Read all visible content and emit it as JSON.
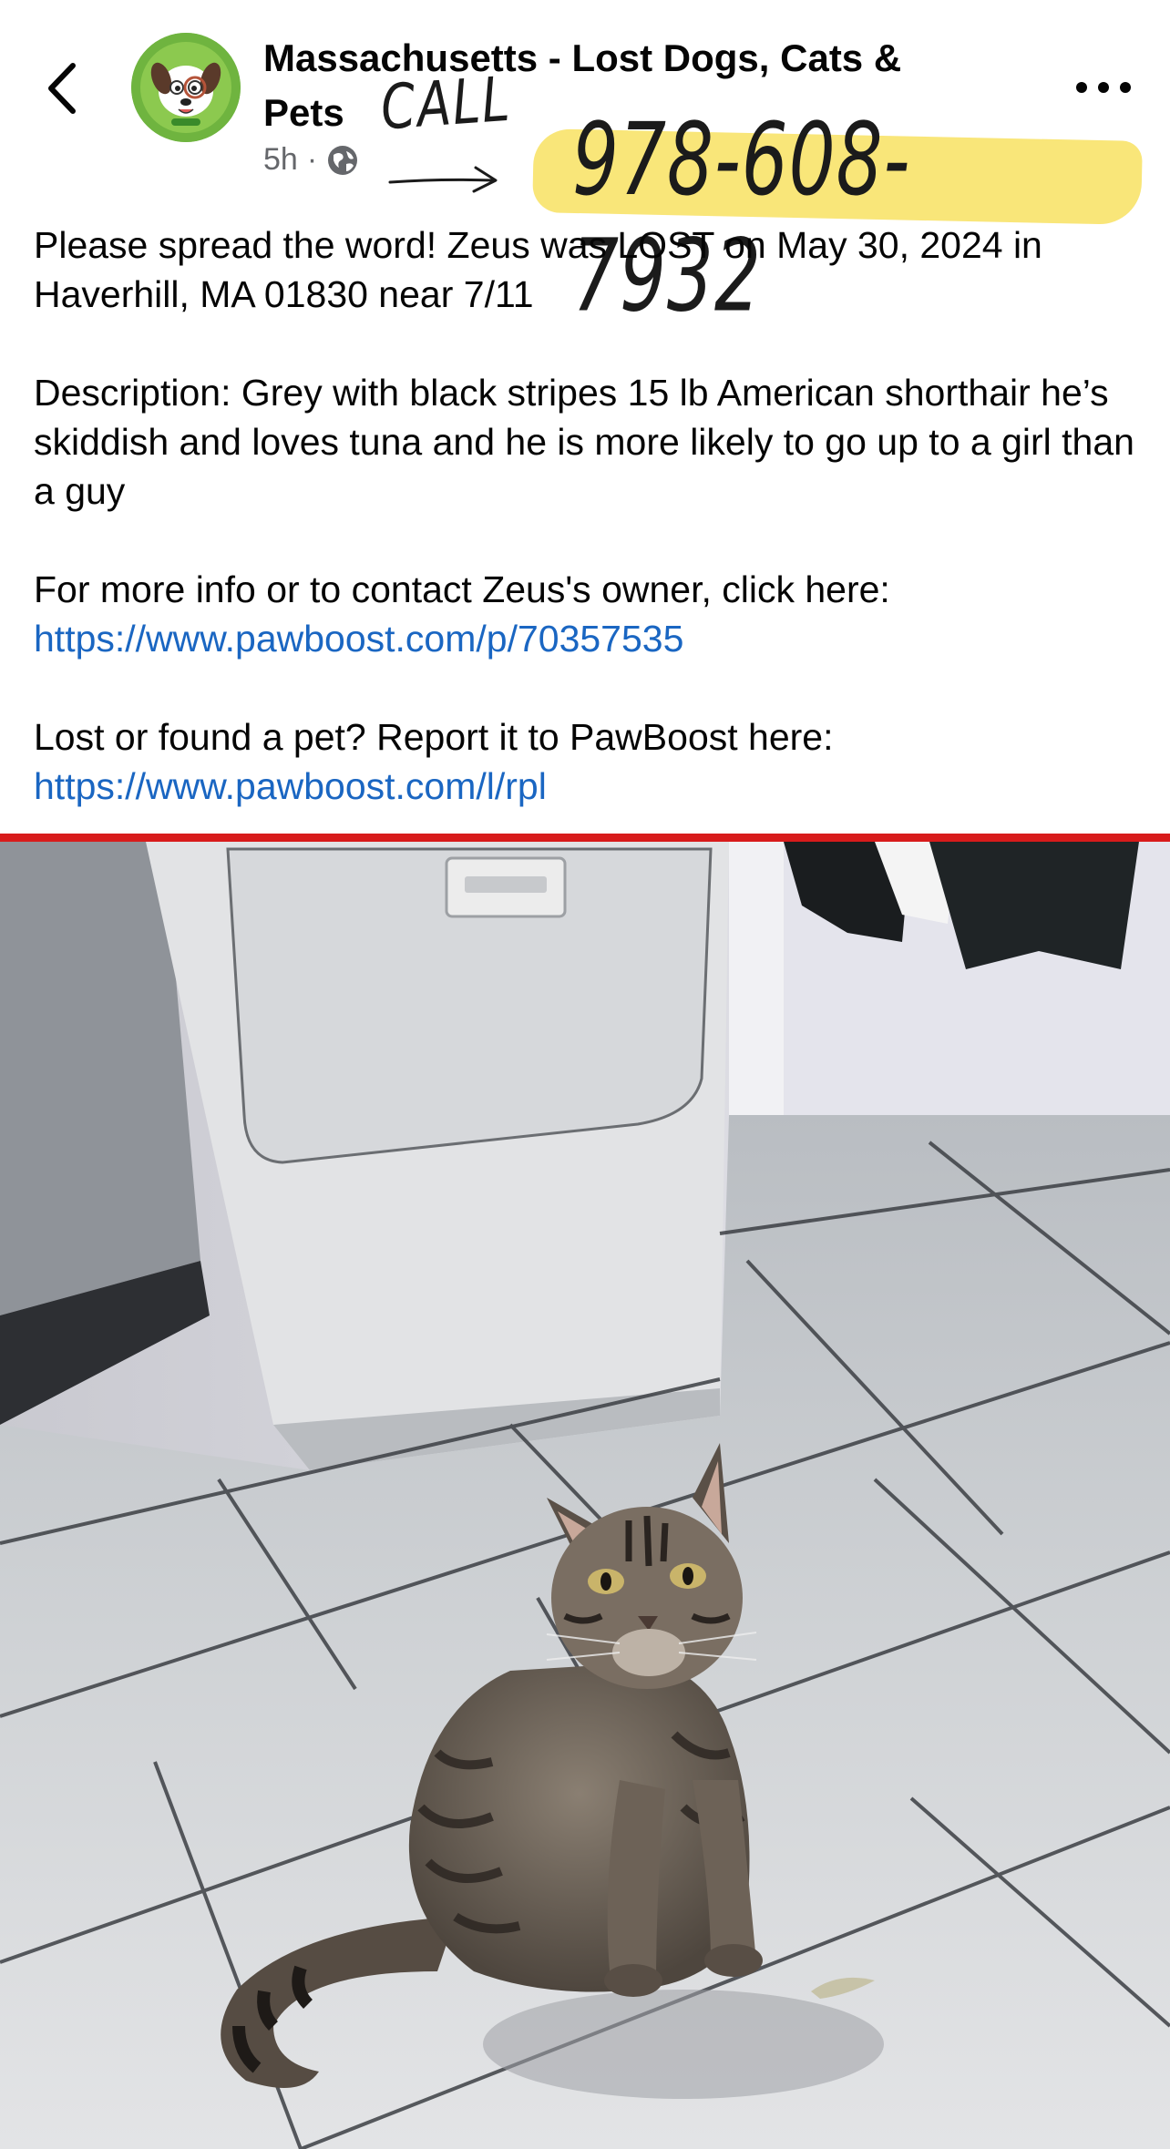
{
  "header": {
    "group_name": "Massachusetts - Lost Dogs, Cats & Pets",
    "time_ago": "5h",
    "separator": "·",
    "visibility_icon": "globe-icon",
    "back_icon": "chevron-left-icon",
    "more_icon": "more-horizontal-icon"
  },
  "annotation": {
    "call_label": "CALL",
    "phone_number": "978-608-7932",
    "highlight_color": "#f8e36a"
  },
  "post": {
    "line1": "Please spread the word! Zeus was LOST on May 30, 2024 in Haverhill, MA 01830 near 7/11",
    "description": "Description: Grey with black stripes 15 lb American shorthair he’s skiddish and loves tuna and he is more likely to go up to a girl than a guy",
    "contact_prompt": "For more info or to contact Zeus's owner, click here:",
    "contact_link": "https://www.pawboost.com/p/70357535",
    "report_prompt": "Lost or found a pet? Report it to PawBoost here:",
    "report_link": "https://www.pawboost.com/l/rpl"
  },
  "colors": {
    "link": "#1a66c2",
    "divider": "#d81b1b",
    "meta_text": "#65676b"
  }
}
